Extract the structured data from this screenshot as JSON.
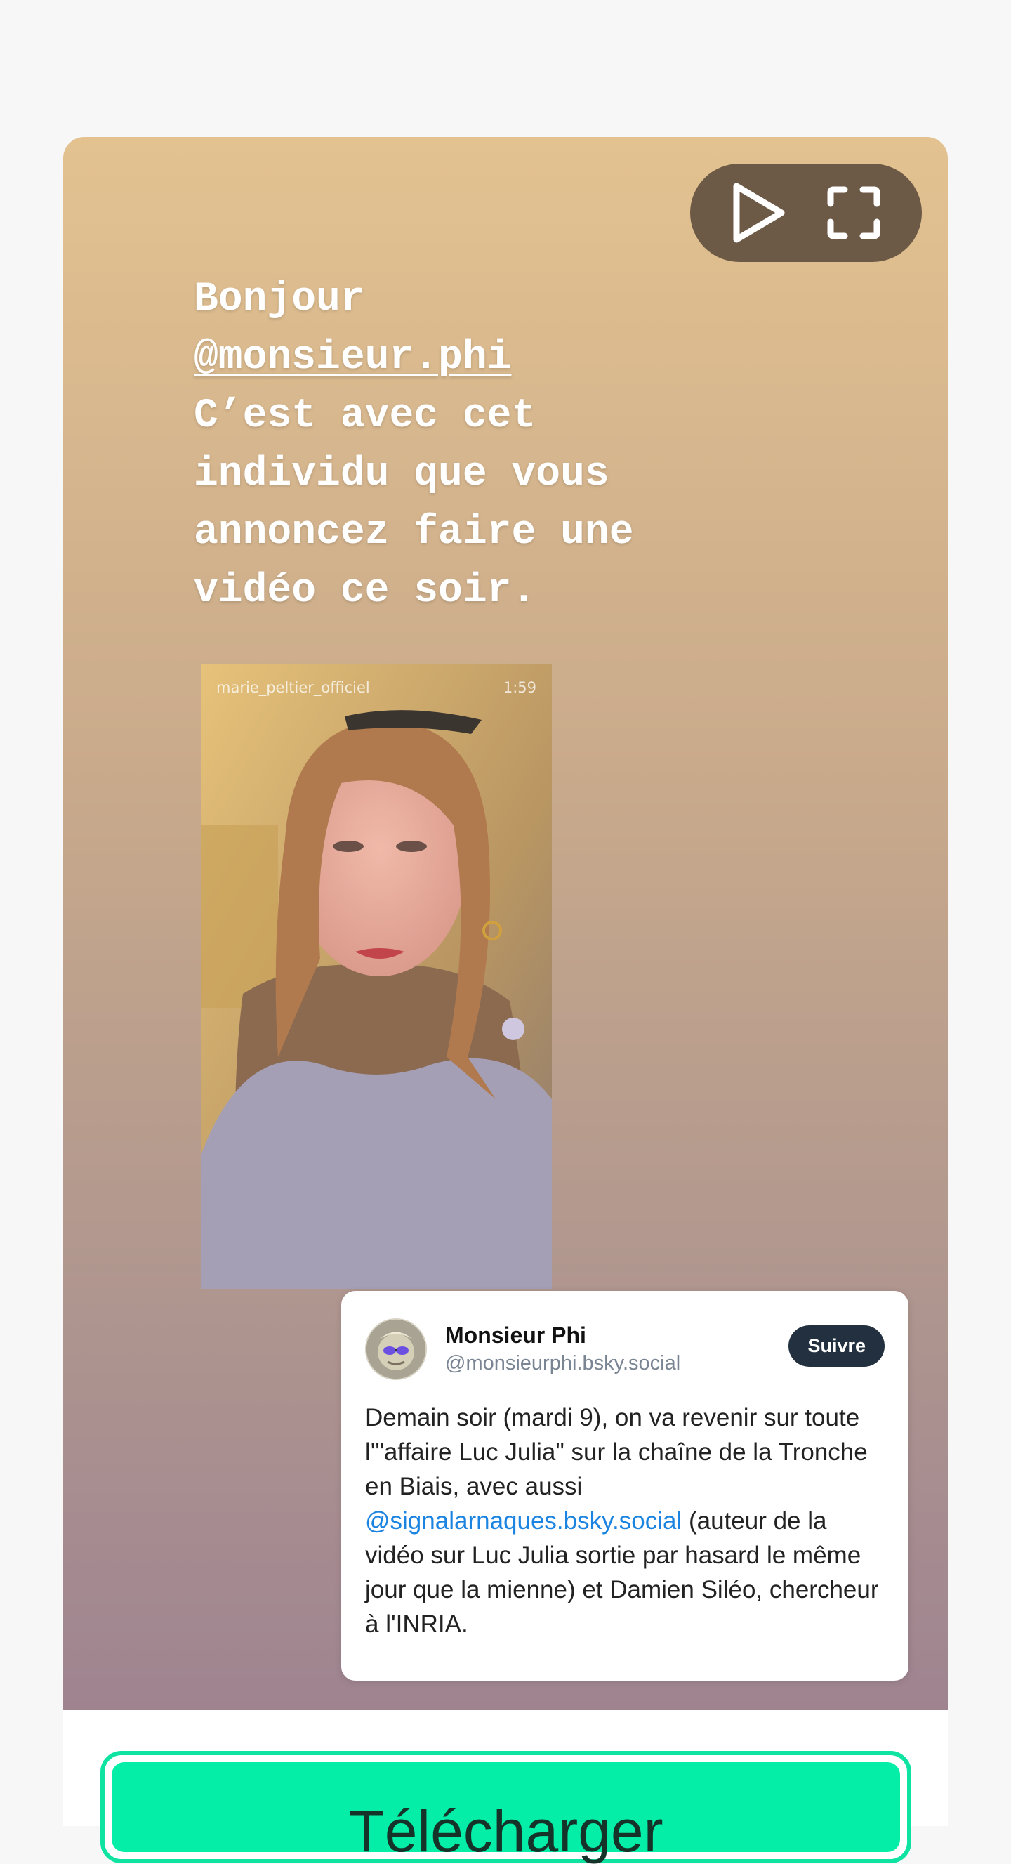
{
  "story": {
    "greeting": "Bonjour",
    "mention": "@monsieur.phi",
    "line3": "C’est avec cet",
    "line4": "individu que vous",
    "line5": "annoncez faire une",
    "line6": "vidéo ce soir."
  },
  "player": {
    "play_icon": "play-icon",
    "fullscreen_icon": "fullscreen-icon"
  },
  "embedded_video": {
    "username": "marie_peltier_officiel",
    "duration": "1:59"
  },
  "post": {
    "display_name": "Monsieur Phi",
    "handle": "@monsieurphi.bsky.social",
    "follow_label": "Suivre",
    "text_before_link": "Demain soir (mardi 9), on va revenir sur toute l'\"affaire Luc Julia\" sur la chaîne de la Tronche en Biais, avec aussi ",
    "link": "@signalarnaques.bsky.social",
    "text_after_link": " (auteur de la vidéo sur Luc Julia sortie par hasard le même jour que la mienne) et Damien Siléo, chercheur à l'INRIA."
  },
  "download": {
    "label": "Télécharger"
  },
  "colors": {
    "accent": "#05eea8",
    "link": "#1b83e0",
    "follow_button": "#22303f"
  }
}
